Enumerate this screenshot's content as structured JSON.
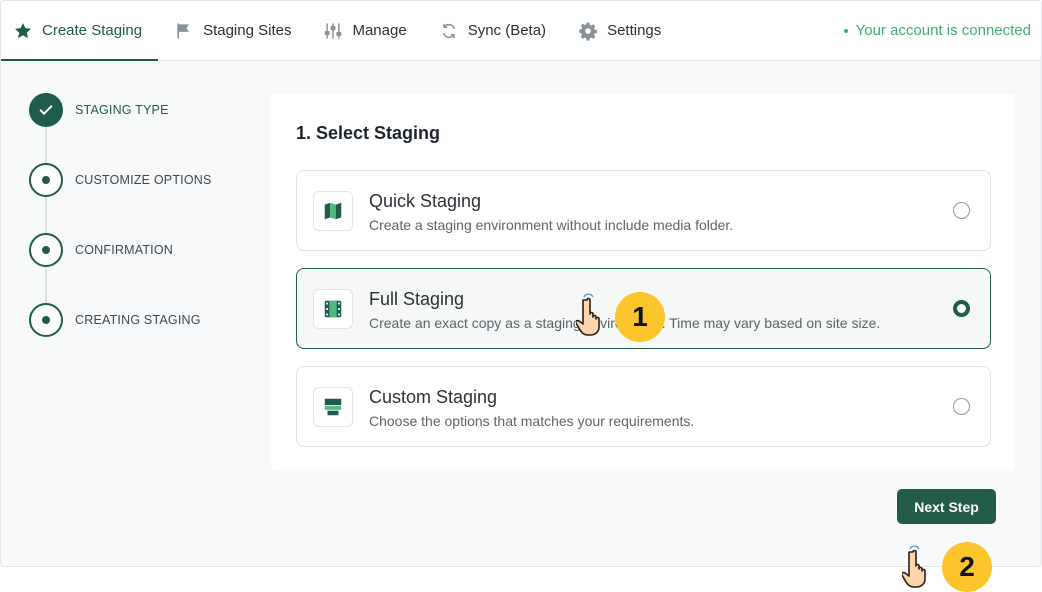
{
  "nav": {
    "tabs": [
      {
        "label": "Create Staging",
        "icon": "star-icon",
        "active": true
      },
      {
        "label": "Staging Sites",
        "icon": "flag-icon"
      },
      {
        "label": "Manage",
        "icon": "sliders-icon"
      },
      {
        "label": "Sync (Beta)",
        "icon": "sync-icon"
      },
      {
        "label": "Settings",
        "icon": "gear-icon"
      }
    ],
    "connection_status": "Your account is connected"
  },
  "steps": [
    {
      "label": "STAGING TYPE",
      "state": "done"
    },
    {
      "label": "CUSTOMIZE OPTIONS",
      "state": "pending"
    },
    {
      "label": "CONFIRMATION",
      "state": "pending"
    },
    {
      "label": "CREATING STAGING",
      "state": "pending"
    }
  ],
  "panel": {
    "title": "1. Select Staging",
    "options": [
      {
        "title": "Quick Staging",
        "description": "Create a staging environment without include media folder.",
        "selected": false,
        "icon": "map-icon"
      },
      {
        "title": "Full Staging",
        "description": "Create an exact copy as a staging environment. Time may vary based on site size.",
        "selected": true,
        "icon": "film-icon"
      },
      {
        "title": "Custom Staging",
        "description": "Choose the options that matches your requirements.",
        "selected": false,
        "icon": "window-icon"
      }
    ]
  },
  "next_button": "Next Step",
  "annotations": [
    "1",
    "2"
  ],
  "colors": {
    "accent": "#1f5c4b",
    "connected": "#3fae6f",
    "badge": "#fcc52c"
  }
}
